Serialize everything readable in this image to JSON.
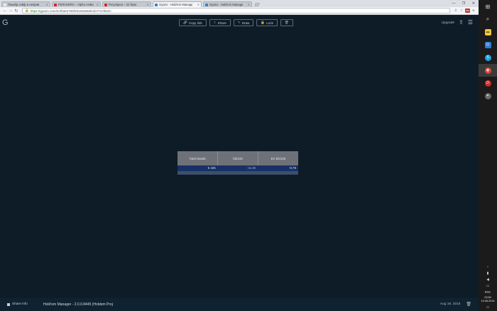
{
  "browser": {
    "tabs": [
      {
        "title": "Покейр сейф и неприв",
        "favicon_color": "#e9e9e9",
        "active": false
      },
      {
        "title": "FERVHERV – Alpha АНКи",
        "favicon_color": "#e02020",
        "active": false
      },
      {
        "title": "Регулярно – 22 базе",
        "favicon_color": "#e02020",
        "active": false
      },
      {
        "title": "Gyazo - Hold'em Manage",
        "favicon_color": "#3a7bd5",
        "active": true
      },
      {
        "title": "Gyazo - Hold'em Manage",
        "favicon_color": "#3a7bd5",
        "active": false
      }
    ],
    "window_controls": [
      "—",
      "❐",
      "✕"
    ],
    "nav": {
      "back": "←",
      "forward": "→",
      "reload": "↻"
    },
    "url_scheme": "https://",
    "url_rest": "gyazo.com/ecf0aee765f25192a56d41b77ccf524c",
    "toolbar_icons": [
      "⇩",
      "☆",
      "ABP",
      "≡"
    ]
  },
  "gyazo": {
    "logo": "G",
    "actions": [
      {
        "id": "copy",
        "icon": "🔗",
        "label": "Copy link"
      },
      {
        "id": "share",
        "icon": "",
        "label": "Share"
      },
      {
        "id": "draw",
        "icon": "✎",
        "label": "Draw"
      },
      {
        "id": "lock",
        "icon": "🔒",
        "label": "Lock"
      },
      {
        "id": "delete",
        "icon": "🗑",
        "label": ""
      }
    ],
    "upgrade": "Upgrade",
    "upload_icon": "⇪",
    "menu_icon": "☰"
  },
  "capture": {
    "headers": [
      "Total Hands",
      "bb/100",
      "EV bb/100"
    ],
    "row": [
      "5 425",
      "-21,92",
      "-0,76"
    ]
  },
  "footer": {
    "share_info": "Share info",
    "title": "Hold'em Manager - 2.0.0.8445 (Holdem Proj",
    "date": "Aug 19, 2016",
    "trash_icon": "🗑"
  },
  "taskbar": {
    "start": "⊞",
    "search": "⌕",
    "apps": [
      {
        "name": "file-explorer",
        "color": "#f2c744",
        "glyph": "▬"
      },
      {
        "name": "store",
        "color": "#2f7bd8",
        "glyph": "⊡"
      },
      {
        "name": "skype",
        "color": "#1fa3e0",
        "glyph": "S"
      },
      {
        "name": "chrome",
        "color": "#d84a3a",
        "glyph": "◉"
      },
      {
        "name": "opera",
        "color": "#d8282a",
        "glyph": "O"
      },
      {
        "name": "app-bird",
        "color": "#6a6a6a",
        "glyph": "✦"
      }
    ],
    "tray_expand": "‹",
    "lang": "РУС",
    "time": "23:59",
    "date": "19.08.2016",
    "notify": "▭"
  }
}
